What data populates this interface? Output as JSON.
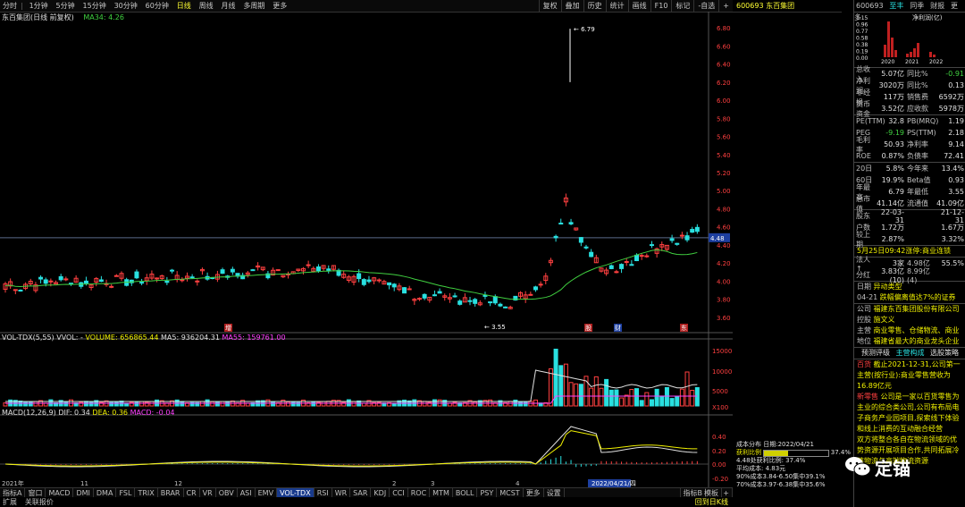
{
  "toolbar": {
    "left": [
      "分时",
      "1分钟",
      "5分钟",
      "15分钟",
      "30分钟",
      "60分钟",
      "日线",
      "周线",
      "月线",
      "多周期",
      "更多"
    ],
    "right": [
      "复权",
      "叠加",
      "历史",
      "统计",
      "画线",
      "F10",
      "标记",
      "-自选",
      "+"
    ]
  },
  "stock": {
    "code_name": "600693 东百集团",
    "code": "600693"
  },
  "main_legend": {
    "title": "东百集团(日线 前复权)",
    "ma": "MA34: 4.26"
  },
  "price_axis": [
    "6.80",
    "6.60",
    "6.40",
    "6.20",
    "6.00",
    "5.80",
    "5.60",
    "5.40",
    "5.20",
    "5.00",
    "4.80",
    "4.60",
    "4.40",
    "4.20",
    "4.00",
    "3.80",
    "3.60"
  ],
  "current_price_tag": "4.48",
  "annotations": {
    "high": "6.79",
    "low": "3.55"
  },
  "vol_legend": {
    "name": "VOL-TDX(5,55)",
    "vvol": "VVOL: -",
    "volume": "VOLUME: 656865.44",
    "ma5": "MA5: 936204.31",
    "ma55": "MA55: 159761.00"
  },
  "vol_axis": [
    "15000",
    "10000",
    "5000",
    "X100"
  ],
  "macd_legend": {
    "name": "MACD(12,26,9)",
    "dif": "DIF: 0.34",
    "dea": "DEA: 0.36",
    "macd": "MACD: -0.04"
  },
  "macd_axis": [
    "0.40",
    "0.20",
    "0.00",
    "-0.20"
  ],
  "date_axis": [
    "2021年",
    "11",
    "12",
    "2",
    "3",
    "4",
    "2022/04/21/四"
  ],
  "marker_badges": [
    "增",
    "股",
    "财",
    "东"
  ],
  "dist_box": {
    "title": "成本分布 日期:2022/04/21",
    "profit_ratio_label": "获利比例",
    "profit_ratio": "37.4%",
    "profit_line": "4.48处获利比例: 37.4%",
    "avg_cost": "平均成本: 4.83元",
    "c90": "90%成本3.84-6.50集中39.1%",
    "c70": "70%成本3.97-6.38集中35.6%"
  },
  "bottom_tabs": [
    "指标A",
    "窗口",
    "MACD",
    "DMI",
    "DMA",
    "FSL",
    "TRIX",
    "BRAR",
    "CR",
    "VR",
    "OBV",
    "ASI",
    "EMV",
    "VOL-TDX",
    "RSI",
    "WR",
    "SAR",
    "KDJ",
    "CCI",
    "ROC",
    "MTM",
    "BOLL",
    "PSY",
    "MCST",
    "更多",
    "设置"
  ],
  "bottom_right": [
    "指标B",
    "模板",
    "+"
  ],
  "bottom2": [
    "扩展",
    "关联报价"
  ],
  "bottom2_right": "回到日K线",
  "right_panel": {
    "header": {
      "code": "600693",
      "tabs": [
        "至丰",
        "同季",
        "财报",
        "更多"
      ]
    },
    "mini_chart": {
      "label": "净利润(亿)",
      "years": [
        "2020",
        "2021",
        "2022"
      ],
      "yticks": [
        "1.15",
        "0.96",
        "0.77",
        "0.58",
        "0.38",
        "0.19",
        "0.00"
      ]
    },
    "fin": [
      [
        "总收入",
        "5.07亿",
        "同比%",
        "-0.91"
      ],
      [
        "净利润",
        "3020万",
        "同比%",
        "0.13"
      ],
      [
        "非经损",
        "117万",
        "销售费",
        "6592万"
      ],
      [
        "货币资金",
        "3.52亿",
        "应收款",
        "5978万"
      ]
    ],
    "val": [
      [
        "PE(TTM)",
        "32.8",
        "PB(MRQ)",
        "1.19"
      ],
      [
        "PEG",
        "-9.19",
        "PS(TTM)",
        "2.18"
      ],
      [
        "毛利率",
        "50.93",
        "净利率",
        "9.14"
      ],
      [
        "ROE",
        "0.87%",
        "负债率",
        "72.41"
      ]
    ],
    "perf": [
      [
        "20日",
        "5.8%",
        "今年来",
        "13.4%"
      ],
      [
        "60日",
        "19.9%",
        "Beta值",
        "0.93"
      ],
      [
        "年最高",
        "6.79",
        "年最低",
        "3.55"
      ],
      [
        "总市值",
        "41.14亿",
        "流通值",
        "41.09亿"
      ]
    ],
    "holders": [
      [
        "股东",
        "22-03-31",
        "",
        "21-12-31"
      ],
      [
        "户数",
        "1.72万",
        "",
        "1.67万"
      ],
      [
        "较上期",
        "2.87%",
        "",
        "3.32%"
      ]
    ],
    "news": "5月25日09:42涨停:商业连锁",
    "inst": [
      [
        "法人↑",
        "3家",
        "4.98亿",
        "55.5%"
      ],
      [
        "分红",
        "3.83亿(10)",
        "8.99亿(4)",
        ""
      ]
    ],
    "event": [
      [
        "日期",
        "异动类型"
      ],
      [
        "04-21",
        "跌幅偏离值达7%的证券"
      ]
    ],
    "company": [
      [
        "公司",
        "福建东百集团股份有限公司"
      ],
      [
        "控股",
        "施文义"
      ],
      [
        "主营",
        "商业零售、仓储物流、商业"
      ],
      [
        "地位",
        "福建省最大的商业龙头企业"
      ]
    ],
    "buttons": [
      "预测评级",
      "主营构成",
      "选股策略"
    ],
    "desc1_label": "百货",
    "desc1": "截止2021-12-31,公司第一主营(按行业):商业零售营收为16.89亿元",
    "desc2_label": "新零售",
    "desc2": "公司是一家以百货零售为主业的综合类公司,公司有布局电子商务产业园项目,探索线下体验和线上消费的互动融合经营",
    "desc3": "双方将整合各自在物流领域的优势资源开展项目合作,共同拓展冷链物流与高端物流资源",
    "watermark": "定锚",
    "right_vertical": [
      "自",
      "我",
      "已",
      "资",
      "评",
      "资",
      "综",
      "大",
      "龙",
      "小"
    ]
  },
  "colors": {
    "up": "#ff4040",
    "down": "#29e0e0",
    "ma": "#40d040",
    "chip_profit": "#d0d000",
    "chip_loss": "#bdbdbd"
  }
}
